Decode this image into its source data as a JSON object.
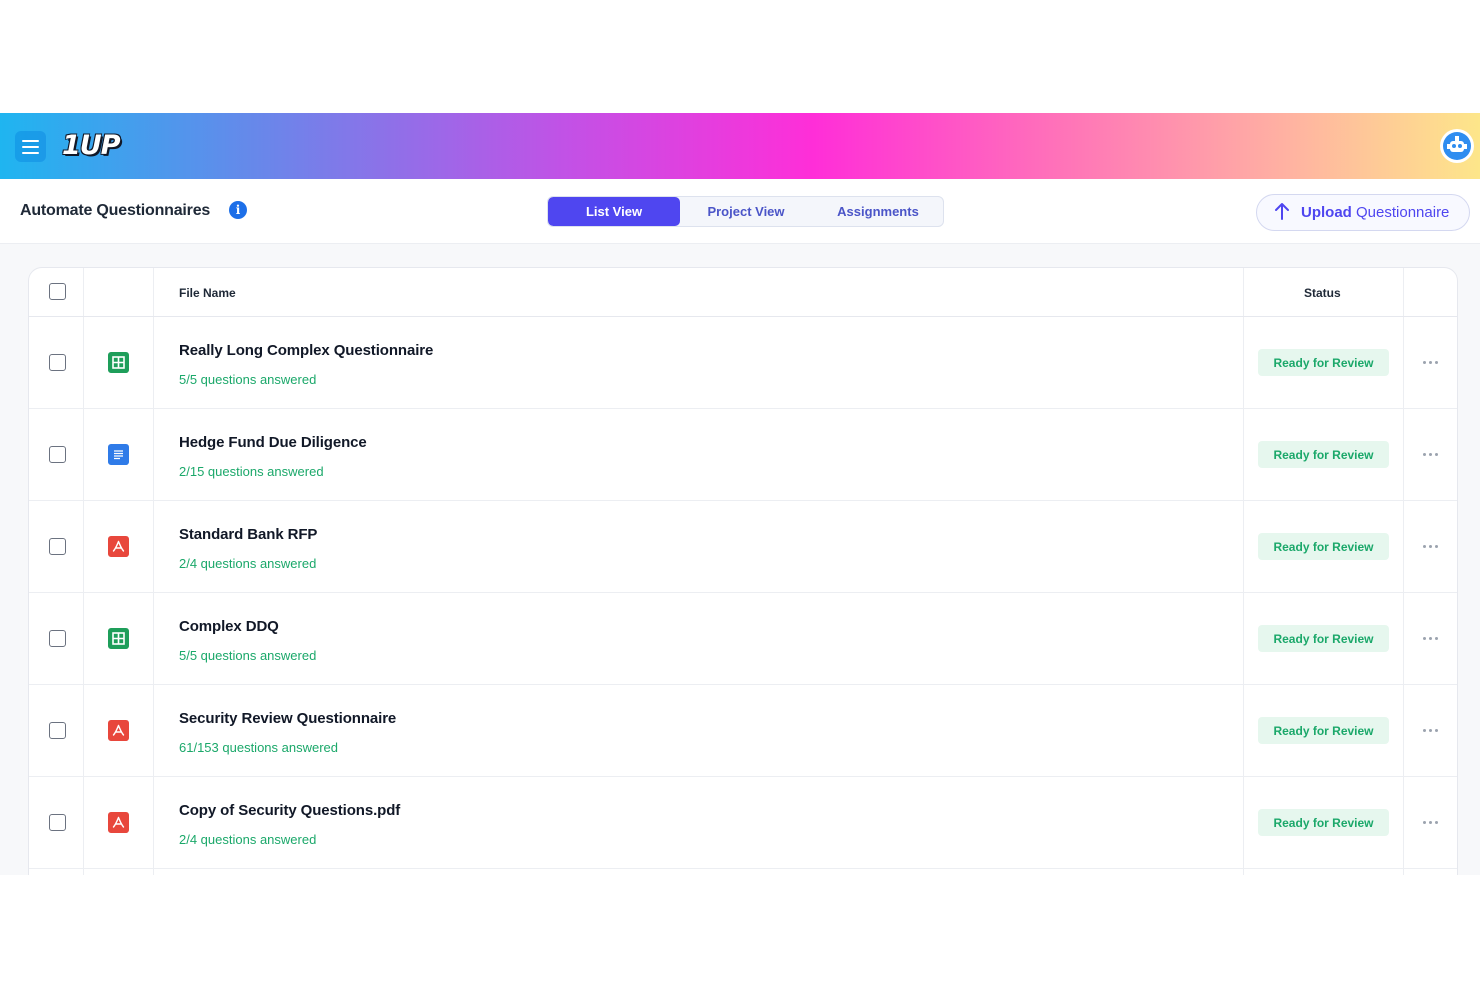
{
  "app": {
    "logo_text": "1UP"
  },
  "header": {
    "title": "Automate Questionnaires",
    "info_glyph": "i",
    "tabs": [
      {
        "label": "List View",
        "active": true
      },
      {
        "label": "Project View",
        "active": false
      },
      {
        "label": "Assignments",
        "active": false
      }
    ],
    "upload": {
      "bold": "Upload",
      "rest": " Questionnaire"
    }
  },
  "table": {
    "columns": {
      "file_name": "File Name",
      "status": "Status"
    },
    "rows": [
      {
        "title": "Really Long Complex Questionnaire",
        "subtitle": "5/5 questions answered",
        "icon": "spreadsheet-icon",
        "status": "Ready for Review"
      },
      {
        "title": "Hedge Fund Due Diligence",
        "subtitle": "2/15 questions answered",
        "icon": "document-icon",
        "status": "Ready for Review"
      },
      {
        "title": "Standard Bank RFP",
        "subtitle": "2/4 questions answered",
        "icon": "pdf-icon",
        "status": "Ready for Review"
      },
      {
        "title": "Complex DDQ",
        "subtitle": "5/5 questions answered",
        "icon": "spreadsheet-icon",
        "status": "Ready for Review"
      },
      {
        "title": "Security Review Questionnaire",
        "subtitle": "61/153 questions answered",
        "icon": "pdf-icon",
        "status": "Ready for Review"
      },
      {
        "title": "Copy of Security Questions.pdf",
        "subtitle": "2/4 questions answered",
        "icon": "pdf-icon",
        "status": "Ready for Review"
      }
    ]
  },
  "colors": {
    "accent": "#4f46f0",
    "success": "#1ba86a",
    "success_bg": "#e6f7ee",
    "sheet": "#1e9e5a",
    "doc": "#2f7be8",
    "pdf": "#e8473c"
  }
}
